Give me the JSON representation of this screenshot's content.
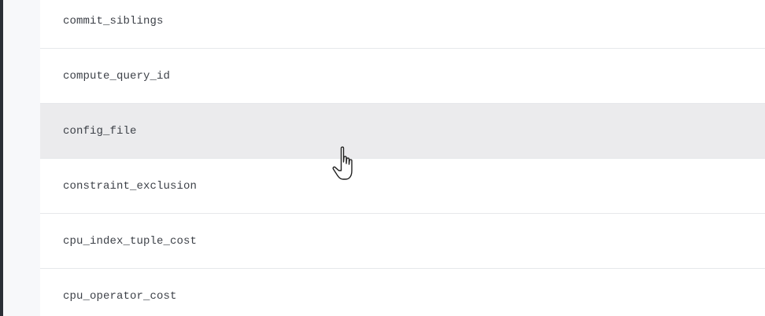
{
  "settings_list": {
    "rows": [
      {
        "name": "commit_siblings"
      },
      {
        "name": "compute_query_id"
      },
      {
        "name": "config_file"
      },
      {
        "name": "constraint_exclusion"
      },
      {
        "name": "cpu_index_tuple_cost"
      },
      {
        "name": "cpu_operator_cost"
      }
    ],
    "hovered_row": "config_file"
  },
  "cursor": {
    "icon": "hand-pointer-icon"
  },
  "colors": {
    "row_background": "#ffffff",
    "row_hover_background": "#ebebed",
    "divider": "#e6e8eb",
    "text": "#3d4148",
    "sidebar": "#2a2f36"
  }
}
